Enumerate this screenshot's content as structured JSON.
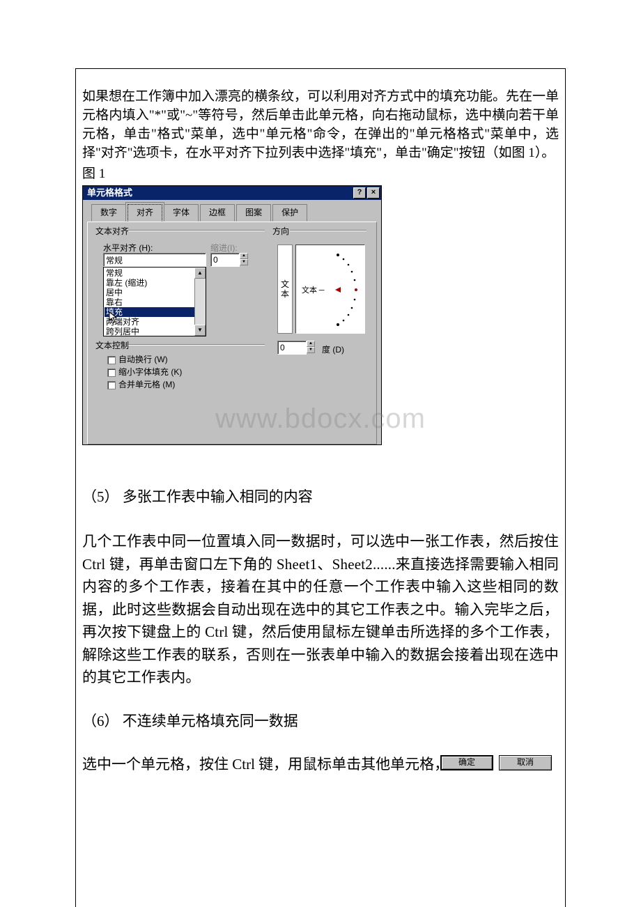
{
  "intro": "如果想在工作簿中加入漂亮的横条纹，可以利用对齐方式中的填充功能。先在一单元格内填入\"*\"或\"~\"等符号，然后单击此单元格，向右拖动鼠标，选中横向若干单元格，单击\"格式\"菜单，选中\"单元格\"命令，在弹出的\"单元格格式\"菜单中，选择\"对齐\"选项卡，在水平对齐下拉列表中选择\"填充\"，单击\"确定\"按钮（如图 1）。",
  "figCaption": "图 1",
  "dialog": {
    "title": "单元格格式",
    "tabs": [
      "数字",
      "对齐",
      "字体",
      "边框",
      "图案",
      "保护"
    ],
    "group_align": "文本对齐",
    "group_orient": "方向",
    "lbl_halign": "水平对齐 (H):",
    "lbl_indent": "缩进(I):",
    "halign_value": "常规",
    "halign_items": [
      "常规",
      "靠左 (缩进)",
      "居中",
      "靠右",
      "填充",
      "两端对齐",
      "跨列居中"
    ],
    "indent_value": "0",
    "group_textctrl": "文本控制",
    "chk_wrap": "自动换行 (W)",
    "chk_shrink": "缩小字体填充 (K)",
    "chk_merge": "合并单元格 (M)",
    "orient_vert": "文本",
    "orient_label": "文本",
    "deg_value": "0",
    "deg_label": "度 (D)",
    "btn_ok": "确定",
    "btn_cancel": "取消"
  },
  "watermark": "www.bdocx.com",
  "section5": "（5） 多张工作表中输入相同的内容",
  "para5": "几个工作表中同一位置填入同一数据时，可以选中一张工作表，然后按住 Ctrl 键，再单击窗口左下角的 Sheet1、Sheet2......来直接选择需要输入相同内容的多个工作表，接着在其中的任意一个工作表中输入这些相同的数据，此时这些数据会自动出现在选中的其它工作表之中。输入完毕之后，再次按下键盘上的 Ctrl 键，然后使用鼠标左键单击所选择的多个工作表，解除这些工作表的联系，否则在一张表单中输入的数据会接着出现在选中的其它工作表内。",
  "section6": "（6） 不连续单元格填充同一数据",
  "para6": "选中一个单元格，按住 Ctrl 键，用鼠标单击其他单元格，就将"
}
